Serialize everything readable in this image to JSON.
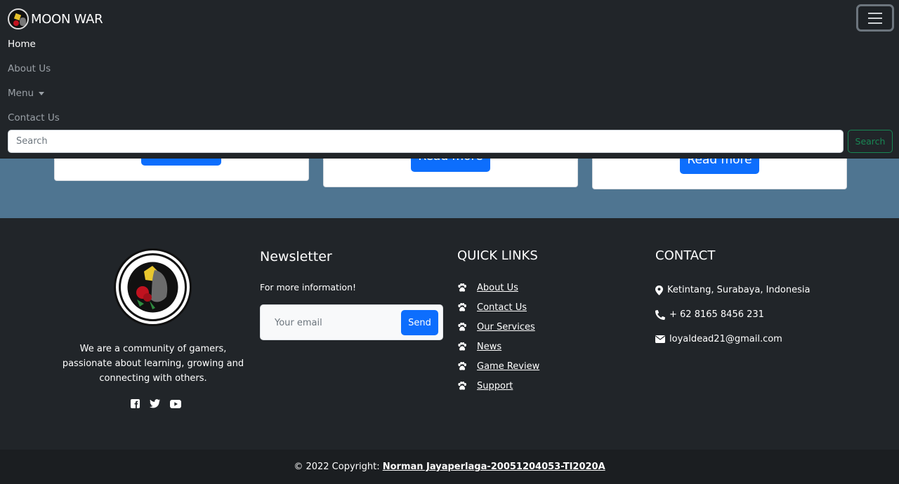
{
  "brand": {
    "name": "MOON WAR"
  },
  "nav": {
    "items": [
      {
        "label": "Home"
      },
      {
        "label": "About Us"
      },
      {
        "label": "Menu"
      },
      {
        "label": "Contact Us"
      }
    ],
    "search_placeholder": "Search",
    "search_button": "Search"
  },
  "cards": [
    {
      "button": ""
    },
    {
      "button": "Read more"
    },
    {
      "button": "Read more"
    }
  ],
  "footer": {
    "about": "We are a community of gamers, passionate about learning, growing and connecting with others.",
    "socials": [
      "facebook-icon",
      "twitter-icon",
      "youtube-icon"
    ],
    "newsletter": {
      "title": "Newsletter",
      "subtitle": "For more information!",
      "placeholder": "Your email",
      "button": "Send"
    },
    "quick_links": {
      "title": "QUICK LINKS",
      "items": [
        "About Us",
        "Contact Us",
        "Our Services",
        "News",
        "Game Review",
        "Support"
      ]
    },
    "contact": {
      "title": "CONTACT",
      "address": "Ketintang, Surabaya, Indonesia",
      "phone": "+ 62 8165 8456 231",
      "email": "loyaldead21@gmail.com"
    },
    "copyright": {
      "prefix": "© 2022 Copyright: ",
      "link": "Norman Jayaperlaga-20051204053-TI2020A"
    }
  },
  "colors": {
    "primary": "#0d6efd",
    "success": "#198754",
    "dark": "#212529",
    "section_bg": "#4f7591"
  }
}
